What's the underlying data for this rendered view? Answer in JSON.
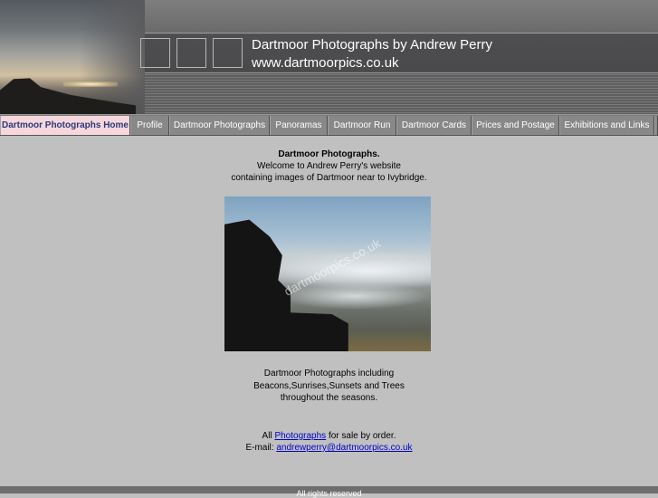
{
  "header": {
    "title": "Dartmoor Photographs by Andrew Perry",
    "url": "www.dartmoorpics.co.uk"
  },
  "nav": {
    "items": [
      {
        "label": "Dartmoor Photographs Home",
        "active": true
      },
      {
        "label": "Profile"
      },
      {
        "label": "Dartmoor Photographs"
      },
      {
        "label": "Panoramas"
      },
      {
        "label": "Dartmoor Run"
      },
      {
        "label": "Dartmoor Cards"
      },
      {
        "label": "Prices and Postage"
      },
      {
        "label": "Exhibitions and Links"
      }
    ]
  },
  "intro": {
    "heading": "Dartmoor Photographs.",
    "line1": "Welcome to Andrew Perry's website",
    "line2": "containing images of Dartmoor near to Ivybridge."
  },
  "photo": {
    "watermark": "dartmoorpics.co.uk"
  },
  "description": {
    "line1": "Dartmoor Photographs including",
    "line2": "Beacons,Sunrises,Sunsets and Trees",
    "line3": "throughout the seasons."
  },
  "contact": {
    "all": "All",
    "photographs_link": "Photographs",
    "for_sale": "for sale by order.",
    "email_label": "E-mail:",
    "email": "andrewperry@dartmoorpics.co.uk"
  },
  "footer": {
    "text": "All rights reserved"
  },
  "colors": {
    "active_tab": "#f5d7dc",
    "active_tab_text": "#2a3a7a",
    "link": "#0000cc",
    "page_bg": "#c0c0c0"
  }
}
